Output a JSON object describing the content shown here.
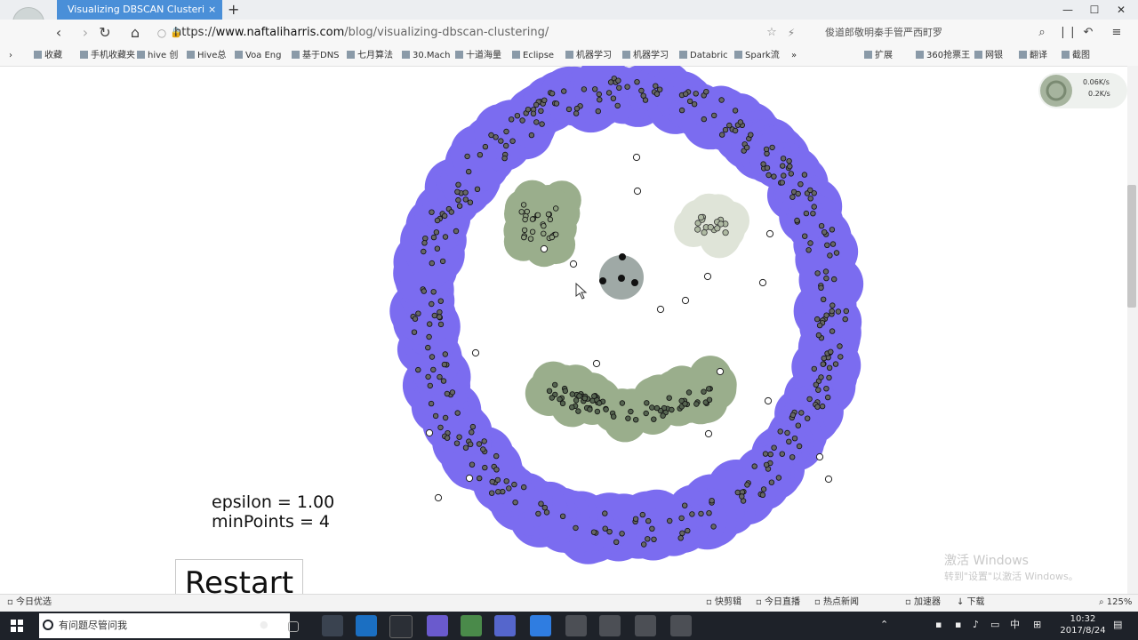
{
  "browser": {
    "tab_title": "Visualizing DBSCAN Clusteri",
    "tab_close": "×",
    "new_tab": "+",
    "url_scheme": "https://",
    "url_host": "www.naftaliharris.com",
    "url_path": "/blog/visualizing-dbscan-clustering/",
    "search_hint": "俊道郎敬明秦手管严西町罗",
    "window_buttons": [
      "—",
      "☐",
      "✕"
    ]
  },
  "bookmarks": [
    "收藏",
    "手机收藏夹",
    "hive 创",
    "Hive总",
    "Voa Eng",
    "基于DNS",
    "七月算法",
    "30.Mach",
    "十道海量",
    "Eclipse",
    "机器学习",
    "机器学习",
    "Databric",
    "Spark流"
  ],
  "bookmarks_right": [
    "扩展",
    "360抢票王",
    "网银",
    "翻译",
    "截图"
  ],
  "speed_widget": {
    "up": "0.06K/s",
    "down": "0.2K/s"
  },
  "page": {
    "epsilon_line": "epsilon = 1.00",
    "minpoints_line": "minPoints = 4",
    "restart_label": "Restart"
  },
  "colors": {
    "ring": "#7b6cf0",
    "cluster_green": "#9aae8c",
    "cluster_pale": "#dfe4d8",
    "cluster_gray": "#9fa9a6"
  },
  "watermark": {
    "line1": "激活 Windows",
    "line2": "转到\"设置\"以激活 Windows。"
  },
  "statusbar": {
    "left": "今日优选",
    "items": [
      "快剪辑",
      "今日直播",
      "热点新闻",
      "加速器",
      "下载",
      "125%"
    ]
  },
  "taskbar": {
    "search_placeholder": "有问题尽管问我",
    "clock_time": "10:32",
    "clock_date": "2017/8/24",
    "ime": "中"
  }
}
